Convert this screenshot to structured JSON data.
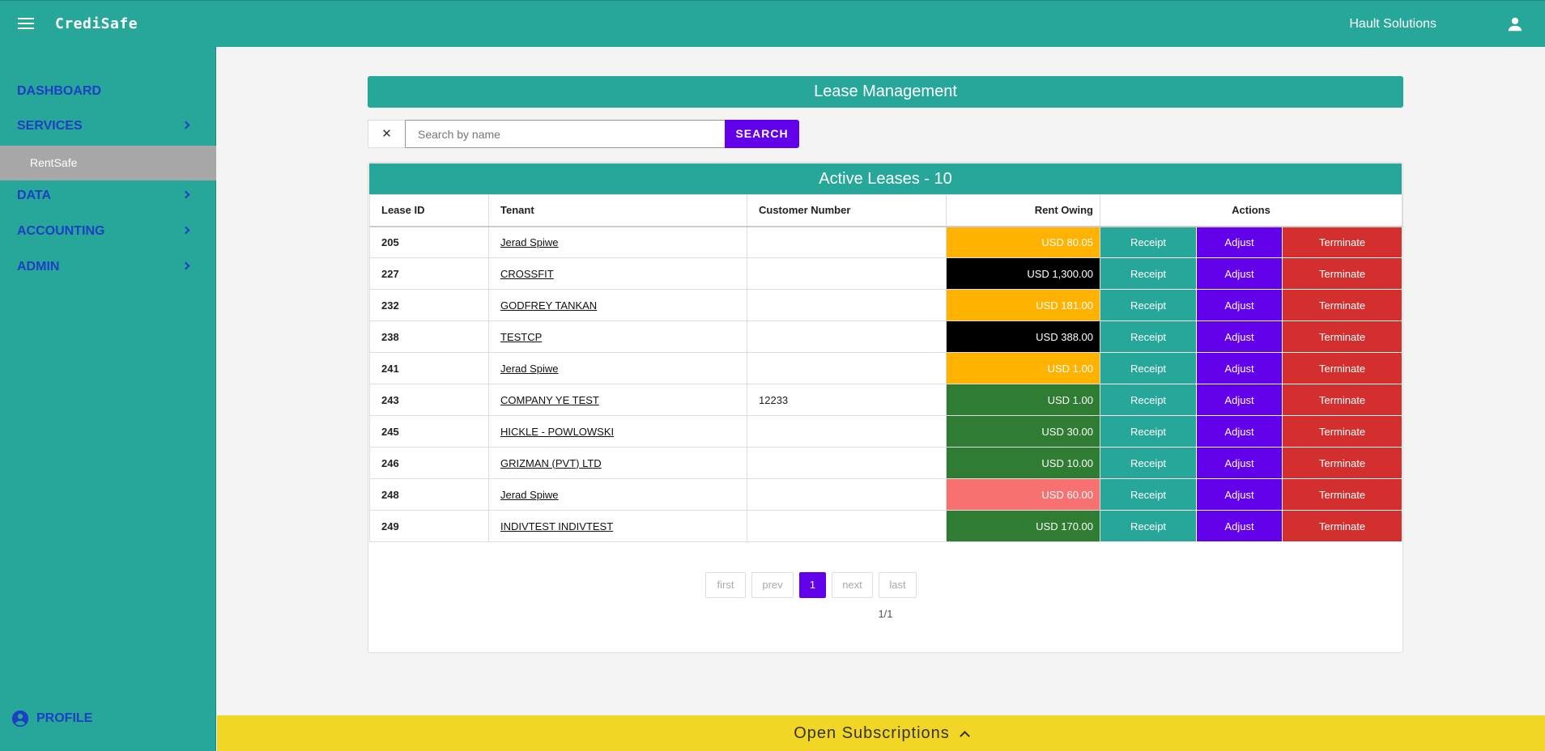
{
  "app": {
    "title": "CrediSafe",
    "user": "Hault Solutions"
  },
  "sidebar": {
    "items": [
      {
        "label": "DASHBOARD"
      },
      {
        "label": "SERVICES"
      },
      {
        "label": "RentSafe"
      },
      {
        "label": "DATA"
      },
      {
        "label": "ACCOUNTING"
      },
      {
        "label": "ADMIN"
      }
    ],
    "profile": "PROFILE"
  },
  "page": {
    "title": "Lease Management"
  },
  "search": {
    "clear": "✕",
    "placeholder": "Search by name",
    "button": "SEARCH"
  },
  "table": {
    "title": "Active Leases - 10",
    "headers": [
      "Lease ID",
      "Tenant",
      "Customer Number",
      "Rent Owing",
      "Actions"
    ],
    "rows": [
      {
        "id": "205",
        "tenant": "Jerad Spiwe",
        "customer": "",
        "owing": "USD 80.05",
        "color": "#ffb300",
        "text": "#ffffff"
      },
      {
        "id": "227",
        "tenant": "CROSSFIT",
        "customer": "",
        "owing": "USD 1,300.00",
        "color": "#000000",
        "text": "#ffffff"
      },
      {
        "id": "232",
        "tenant": "GODFREY TANKAN",
        "customer": "",
        "owing": "USD 181.00",
        "color": "#ffb300",
        "text": "#ffffff"
      },
      {
        "id": "238",
        "tenant": "TESTCP",
        "customer": "",
        "owing": "USD 388.00",
        "color": "#000000",
        "text": "#ffffff"
      },
      {
        "id": "241",
        "tenant": "Jerad Spiwe",
        "customer": "",
        "owing": "USD 1.00",
        "color": "#ffb300",
        "text": "#ffffff"
      },
      {
        "id": "243",
        "tenant": "COMPANY YE TEST",
        "customer": "12233",
        "owing": "USD 1.00",
        "color": "#2e7d32",
        "text": "#ffffff"
      },
      {
        "id": "245",
        "tenant": "HICKLE - POWLOWSKI",
        "customer": "",
        "owing": "USD 30.00",
        "color": "#2e7d32",
        "text": "#ffffff"
      },
      {
        "id": "246",
        "tenant": "GRIZMAN (PVT) LTD",
        "customer": "",
        "owing": "USD 10.00",
        "color": "#2e7d32",
        "text": "#ffffff"
      },
      {
        "id": "248",
        "tenant": "Jerad Spiwe",
        "customer": "",
        "owing": "USD 60.00",
        "color": "#f87171",
        "text": "#ffffff"
      },
      {
        "id": "249",
        "tenant": "INDIVTEST INDIVTEST",
        "customer": "",
        "owing": "USD 170.00",
        "color": "#2e7d32",
        "text": "#ffffff"
      }
    ],
    "actions": {
      "receipt": "Receipt",
      "adjust": "Adjust",
      "terminate": "Terminate"
    }
  },
  "pagination": {
    "first": "first",
    "prev": "prev",
    "current": "1",
    "next": "next",
    "last": "last",
    "info": "1/1"
  },
  "footer": {
    "subscriptions": "Open Subscriptions"
  },
  "colors": {
    "teal": "#27a79a",
    "purple": "#6200ea",
    "red": "#d32f2f",
    "yellow": "#f2d626",
    "navlink": "#1d3fc4"
  }
}
